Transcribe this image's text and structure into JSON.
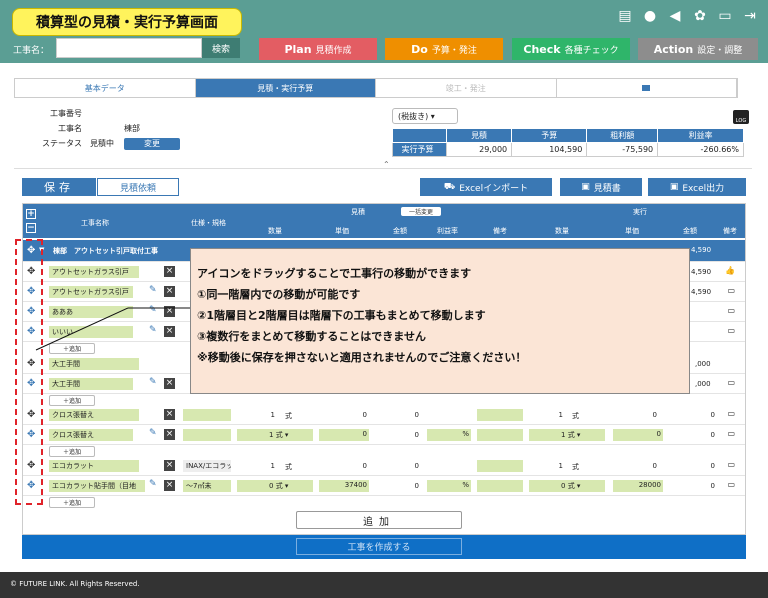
{
  "header": {
    "title": "積算型の見積・実行予算画面",
    "kouji_label": "工事名：",
    "search_label": "検索",
    "phases": [
      {
        "key": "Plan",
        "label": "見積作成",
        "color": "#e35d63"
      },
      {
        "key": "Do",
        "label": "予算・発注",
        "color": "#ef8f00"
      },
      {
        "key": "Check",
        "label": "各種チェック",
        "color": "#2fb56a"
      },
      {
        "key": "Action",
        "label": "設定・調整",
        "color": "#8d8d8d"
      }
    ]
  },
  "tabs": [
    {
      "label": "基本データ",
      "state": "normal"
    },
    {
      "label": "見積・実行予算",
      "state": "active"
    },
    {
      "label": "竣工・発注",
      "state": "dim"
    },
    {
      "label": "",
      "state": "normal"
    }
  ],
  "info": {
    "koji_no_label": "工事番号",
    "koji_no": "",
    "koji_name_label": "工事名",
    "koji_name": "棟部",
    "status_label": "ステータス",
    "status": "見積中",
    "change_label": "変更"
  },
  "tax_select": "(税抜き)",
  "log_label": "LOG",
  "budget": {
    "headers": [
      "見積",
      "予算",
      "粗利額",
      "利益率"
    ],
    "row_label": "実行予算",
    "values": [
      "29,000",
      "104,590",
      "-75,590",
      "-260.66%"
    ]
  },
  "toolbar": {
    "save": "保存",
    "request": "見積依頼",
    "excel_import": "Excelインポート",
    "estimate": "見積書",
    "excel_export": "Excel出力"
  },
  "grid_header": {
    "name": "工事名称",
    "spec": "仕様・規格",
    "estimate": "見積",
    "bulk_change": "一括変更",
    "execution": "実行",
    "qty": "数量",
    "unit_price": "単価",
    "amount": "金額",
    "margin": "利益率",
    "note": "備考",
    "exec_qty": "数量",
    "exec_price": "単価",
    "exec_amount": "金額",
    "exec_note": "備考"
  },
  "parent_row": {
    "text": "棟部　アウトセット引戸取付工事",
    "right_value": "4,590"
  },
  "rows": [
    {
      "name": "アウトセットガラス引戸",
      "right": "4,590"
    },
    {
      "name": "アウトセットガラス引戸",
      "right": "4,590"
    },
    {
      "name": "あああ",
      "right": ""
    },
    {
      "name": "いいい",
      "right": ""
    }
  ],
  "add_small": "＋追加",
  "group2": {
    "name": "大工手間",
    "sub": "大工手間",
    "right1": ",000",
    "right2": ",000"
  },
  "group3": {
    "name": "クロス張替え",
    "sub": "クロス張替え",
    "qty": "1",
    "unit": "式",
    "price": "0",
    "amount": "0",
    "exec_qty": "1",
    "exec_unit": "式",
    "exec_price": "0",
    "exec_amount": "0",
    "sub_qty": "1",
    "sub_unit": "式",
    "sub_price": "0",
    "sub_amount": "0",
    "pct": "%",
    "sub_exec_qty": "1",
    "sub_exec_unit": "式",
    "sub_exec_price": "0",
    "sub_exec_amount": "0"
  },
  "group4": {
    "name": "エコカラット",
    "spec": "INAX/エコラッ",
    "qty": "1",
    "unit": "式",
    "price": "0",
    "amount": "0",
    "exec_qty": "1",
    "exec_unit": "式",
    "exec_price": "0",
    "exec_amount": "0",
    "sub": "エコカラット貼手間（目地",
    "sub_spec": "〜7㎡未",
    "sub_qty": "0",
    "sub_unit": "式",
    "sub_price": "37400",
    "sub_amount": "0",
    "pct": "%",
    "sub_exec_qty": "0",
    "sub_exec_unit": "式",
    "sub_exec_price": "28000",
    "sub_exec_amount": "0"
  },
  "callout": [
    "アイコンをドラッグすることで工事行の移動ができます",
    "①同一階層内での移動が可能です",
    "②1階層目と2階層目は階層下の工事もまとめて移動します",
    "③複数行をまとめて移動することはできません",
    "※移動後に保存を押さないと適用されませんのでご注意ください！"
  ],
  "add_main": "追加",
  "create_label": "工事を作成する",
  "footer": "© FUTURE LINK. All Rights Reserved."
}
